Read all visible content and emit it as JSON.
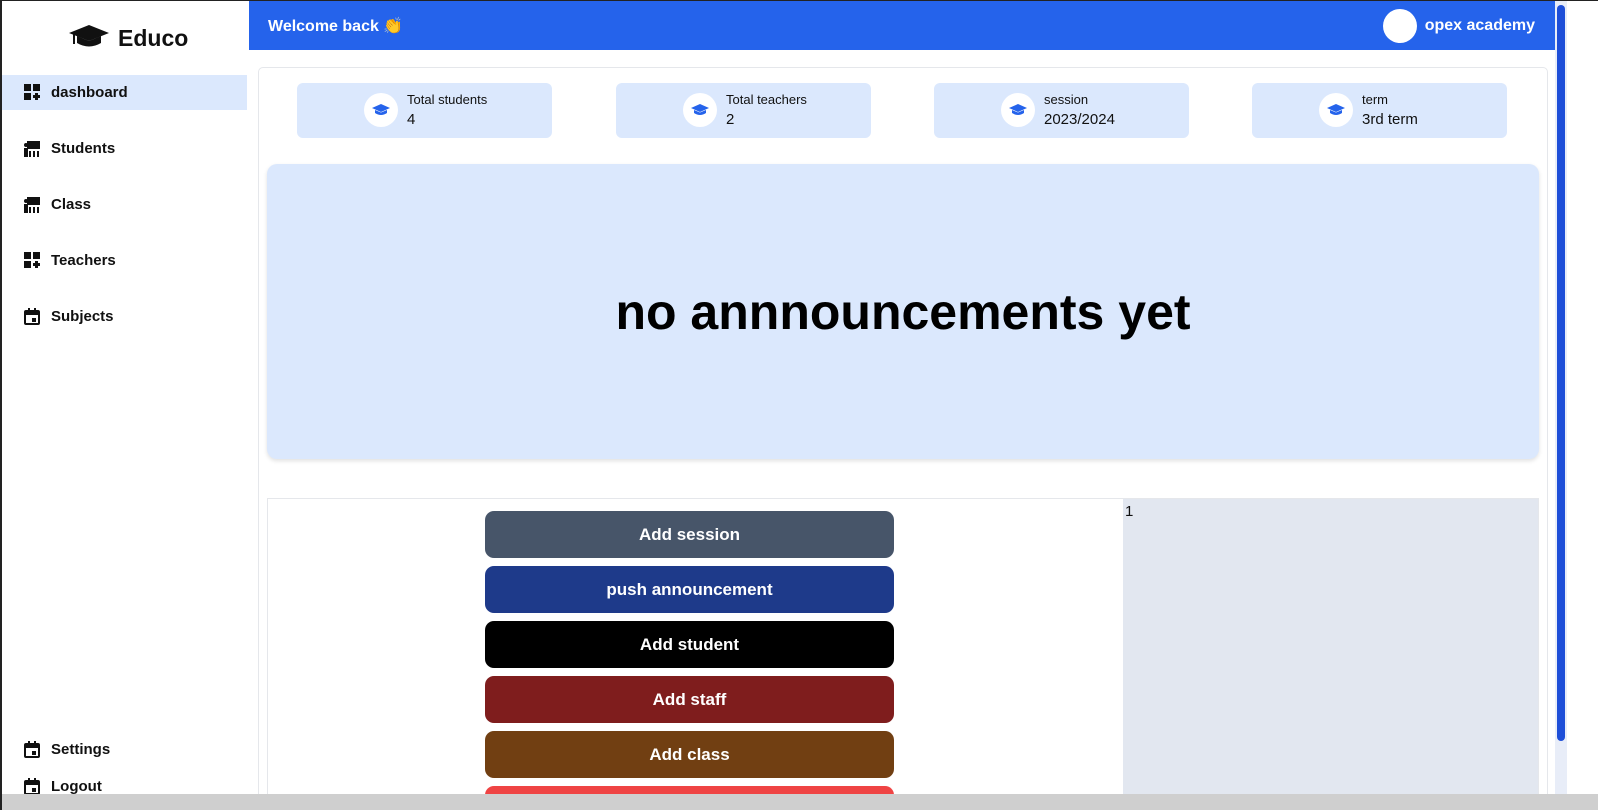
{
  "brand": {
    "name": "Educo",
    "icon": "graduation-cap-icon"
  },
  "sidebar": {
    "items": [
      {
        "label": "dashboard",
        "icon": "dashboard-icon",
        "active": true
      },
      {
        "label": "Students",
        "icon": "classroom-icon"
      },
      {
        "label": "Class",
        "icon": "classroom-icon"
      },
      {
        "label": "Teachers",
        "icon": "dashboard-icon"
      },
      {
        "label": "Subjects",
        "icon": "calendar-icon"
      }
    ],
    "bottom_items": [
      {
        "label": "Settings",
        "icon": "calendar-icon"
      },
      {
        "label": "Logout",
        "icon": "calendar-icon"
      }
    ]
  },
  "header": {
    "welcome": "Welcome back 👏",
    "user_name": "opex academy"
  },
  "stats": [
    {
      "label": "Total students",
      "value": "4",
      "icon": "graduation-cap-icon"
    },
    {
      "label": "Total teachers",
      "value": "2",
      "icon": "graduation-cap-icon"
    },
    {
      "label": "session",
      "value": "2023/2024",
      "icon": "graduation-cap-icon"
    },
    {
      "label": "term",
      "value": "3rd term",
      "icon": "graduation-cap-icon"
    }
  ],
  "announcement": {
    "text": "no annnouncements yet"
  },
  "actions": [
    {
      "label": "Add session",
      "color": "#475569"
    },
    {
      "label": "push announcement",
      "color": "#1e3a8a"
    },
    {
      "label": "Add student",
      "color": "#000000"
    },
    {
      "label": "Add staff",
      "color": "#7f1d1d"
    },
    {
      "label": "Add class",
      "color": "#713f12"
    },
    {
      "label": "",
      "color": "#ef4444"
    }
  ],
  "side_panel": {
    "count": "1"
  },
  "colors": {
    "primary": "#2563eb",
    "light": "#dbe8fd",
    "panel": "#e2e7f0"
  }
}
